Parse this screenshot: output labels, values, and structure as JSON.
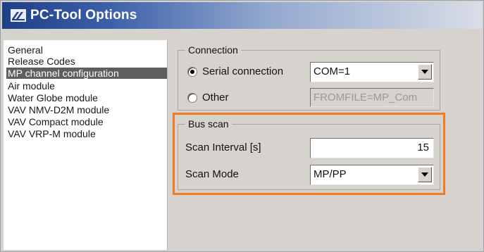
{
  "window": {
    "title": "PC-Tool Options",
    "logo_icon": "app-logo-icon"
  },
  "sidebar": {
    "items": [
      {
        "label": "General",
        "selected": false
      },
      {
        "label": "Release Codes",
        "selected": false
      },
      {
        "label": "MP channel configuration",
        "selected": true
      },
      {
        "label": "Air module",
        "selected": false
      },
      {
        "label": "Water Globe module",
        "selected": false
      },
      {
        "label": "VAV NMV-D2M module",
        "selected": false
      },
      {
        "label": "VAV Compact module",
        "selected": false
      },
      {
        "label": "VAV VRP-M module",
        "selected": false
      }
    ]
  },
  "connection": {
    "group_label": "Connection",
    "serial_label": "Serial connection",
    "serial_value": "COM=1",
    "other_label": "Other",
    "other_value": "FROMFILE=MP_Com"
  },
  "bus_scan": {
    "group_label": "Bus scan",
    "interval_label": "Scan Interval [s]",
    "interval_value": "15",
    "mode_label": "Scan Mode",
    "mode_value": "MP/PP"
  },
  "colors": {
    "highlight": "#f07c21",
    "title_bar": "#1f3f86",
    "selected_item": "#5e5e5e"
  }
}
